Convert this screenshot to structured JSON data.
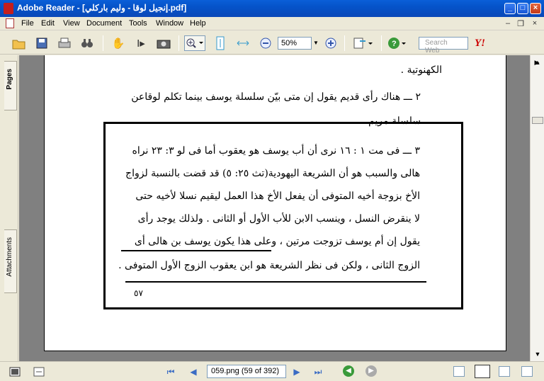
{
  "window": {
    "title": "Adobe Reader - [إنجيل لوقا - وليم باركلي.pdf]",
    "buttons": {
      "minimize": "_",
      "maximize": "□",
      "close": "×"
    }
  },
  "menubar": {
    "items": [
      "File",
      "Edit",
      "View",
      "Document",
      "Tools",
      "Window",
      "Help"
    ],
    "mdi": {
      "minimize": "–",
      "restore": "❐",
      "close": "×"
    }
  },
  "toolbar": {
    "zoom_value": "50%",
    "search_placeholder": "Search Web",
    "yahoo_logo": "Y!"
  },
  "sidepanel": {
    "tab_pages": "Pages",
    "tab_attachments": "Attachments"
  },
  "document": {
    "line1": "الكهنوتية .",
    "line2": "٢ ـــ هناك رأى قديم يقول إن متى بيّن سلسلة يوسف بينما تكلم لوقاعن",
    "line3": "سلسلة مريم .",
    "box_lines": [
      "٣ ـــ فى مت ١ : ١٦ نرى أن أب يوسف هو يعقوب أما فى لو ٣: ٢٣ نراه",
      "هالى   والسبب هو أن الشريعة اليهودية(تث ٢٥: ٥) قد قضت بالنسبة لزواج",
      "الأخ بزوجة أخيه المتوفى أن يفعل الأخ هذا العمل ليقيم نسلا  لأخيه حتى",
      "لا ينقرض النسل ، وينسب الابن  للأب  الأول أو الثانى . ولذلك يوجد رأى",
      "يقول إن أم يوسف تزوجت مرتين ، وعلى هذا يكون يوسف بن هالى أى",
      "الزوج الثانى ، ولكن فى نظر الشريعة هو ابن يعقوب الزوج الأول المتوفى ."
    ],
    "page_number": "٥٧"
  },
  "statusbar": {
    "page_display": "059.png  (59 of 392)"
  }
}
